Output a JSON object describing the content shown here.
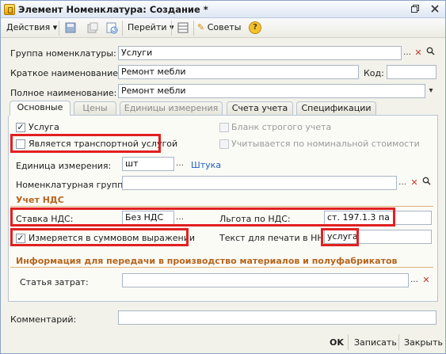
{
  "window": {
    "title": "Элемент Номенклатура: Создание *"
  },
  "toolbar": {
    "actions": "Действия",
    "goto": "Перейти",
    "tips": "Советы",
    "help": "?"
  },
  "form": {
    "group_label": "Группа номенклатуры:",
    "group_value": "Услуги",
    "short_name_label": "Краткое наименование:",
    "short_name_value": "Ремонт мебли",
    "code_label": "Код:",
    "code_value": "",
    "full_name_label": "Полное наименование:",
    "full_name_value": "Ремонт мебли"
  },
  "tabs": [
    "Основные",
    "Цены",
    "Единицы измерения",
    "Счета учета",
    "Спецификации"
  ],
  "main": {
    "service_label": "Услуга",
    "service_checked": true,
    "transport_label": "Является транспортной услугой",
    "transport_checked": false,
    "strict_blank_label": "Бланк строгого учета",
    "nominal_label": "Учитывается по номинальной стоимости",
    "unit_label": "Единица измерения:",
    "unit_value": "шт",
    "unit_link": "Штука",
    "nom_group_label": "Номенклатурная группа:",
    "nom_group_value": "",
    "vat_section": "Учет НДС",
    "vat_rate_label": "Ставка НДС:",
    "vat_rate_value": "Без НДС",
    "vat_benefit_label": "Льгота по НДС:",
    "vat_benefit_value": "ст. 197.1.3 па",
    "sum_label": "Измеряется в суммовом выражении",
    "sum_checked": true,
    "print_text_label": "Текст для печати в НН:",
    "print_text_value": "услуга",
    "prod_section": "Информация для передачи в производство материалов и полуфабрикатов",
    "cost_label": "Статья затрат:",
    "cost_value": ""
  },
  "comment": {
    "label": "Комментарий:",
    "value": ""
  },
  "footer": {
    "ok": "OK",
    "write": "Записать",
    "close": "Закрыть"
  },
  "colors": {
    "highlight": "#e12020",
    "section": "#b5651d",
    "link": "#1f5fbf"
  }
}
